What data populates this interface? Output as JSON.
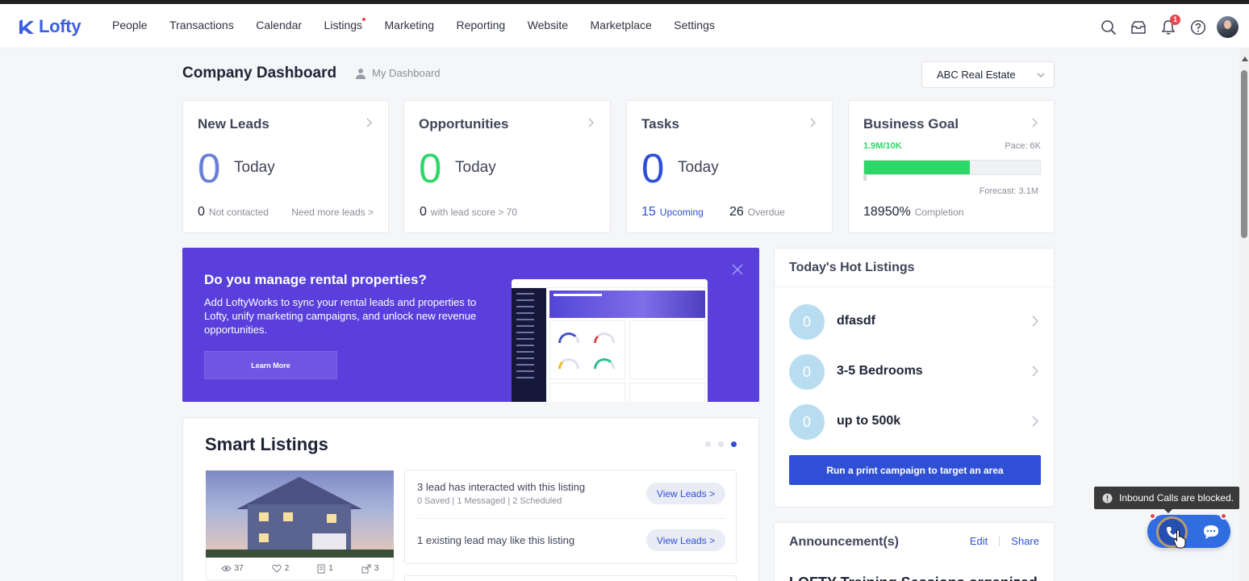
{
  "brand": {
    "name": "Lofty",
    "color": "#3b5fe0"
  },
  "nav": {
    "items": [
      {
        "label": "People"
      },
      {
        "label": "Transactions"
      },
      {
        "label": "Calendar"
      },
      {
        "label": "Listings",
        "has_dot": true
      },
      {
        "label": "Marketing"
      },
      {
        "label": "Reporting"
      },
      {
        "label": "Website"
      },
      {
        "label": "Marketplace"
      },
      {
        "label": "Settings"
      }
    ],
    "icons": [
      "search-icon",
      "inbox-icon",
      "bell-icon",
      "help-icon"
    ],
    "notification_count": "1"
  },
  "header": {
    "title": "Company Dashboard",
    "my_dashboard": "My Dashboard",
    "company": "ABC Real Estate"
  },
  "cards": {
    "new_leads": {
      "title": "New Leads",
      "count": "0",
      "period": "Today",
      "not_contacted_count": "0",
      "not_contacted_label": "Not contacted",
      "link": "Need more leads >",
      "accent": "#6b7fd7"
    },
    "opportunities": {
      "title": "Opportunities",
      "count": "0",
      "period": "Today",
      "score_count": "0",
      "score_label": "with lead score > 70",
      "accent": "#2fd76b"
    },
    "tasks": {
      "title": "Tasks",
      "count": "0",
      "period": "Today",
      "upcoming_count": "15",
      "upcoming_label": "Upcoming",
      "overdue_count": "26",
      "overdue_label": "Overdue",
      "accent": "#2f50d6"
    },
    "business_goal": {
      "title": "Business Goal",
      "progress_label": "1.9M/10K",
      "pace": "Pace: 6K",
      "forecast": "Forecast: 3.1M",
      "completion_value": "18950%",
      "completion_label": "Completion",
      "fill_fraction": 0.6,
      "accent": "#2fd76b"
    }
  },
  "banner": {
    "title": "Do you manage rental properties?",
    "text": "Add LoftyWorks to sync your rental leads and properties to Lofty, unify marketing campaigns, and unlock new revenue opportunities.",
    "button": "Learn More",
    "color": "#5a3fdc"
  },
  "hot_listings": {
    "title": "Today's Hot Listings",
    "items": [
      {
        "count": "0",
        "name": "dfasdf"
      },
      {
        "count": "0",
        "name": "3-5 Bedrooms"
      },
      {
        "count": "0",
        "name": "up to 500k"
      }
    ],
    "button": "Run a print campaign to target an area"
  },
  "smart_listings": {
    "title": "Smart Listings",
    "active_dot": 3,
    "listing_stats": {
      "views": "37",
      "likes": "2",
      "docs": "1",
      "shares": "3"
    },
    "interactions": [
      {
        "text": "3 lead has interacted with this listing",
        "sub": "0 Saved | 1 Messaged | 2 Scheduled",
        "button": "View Leads >"
      },
      {
        "text": "1 existing lead may like this listing",
        "sub": "",
        "button": "View Leads >"
      }
    ]
  },
  "announcements": {
    "title": "Announcement(s)",
    "edit": "Edit",
    "share": "Share",
    "first_item": "LOFTY Training Sessions organized"
  },
  "call_widget": {
    "toast": "Inbound Calls are blocked."
  }
}
